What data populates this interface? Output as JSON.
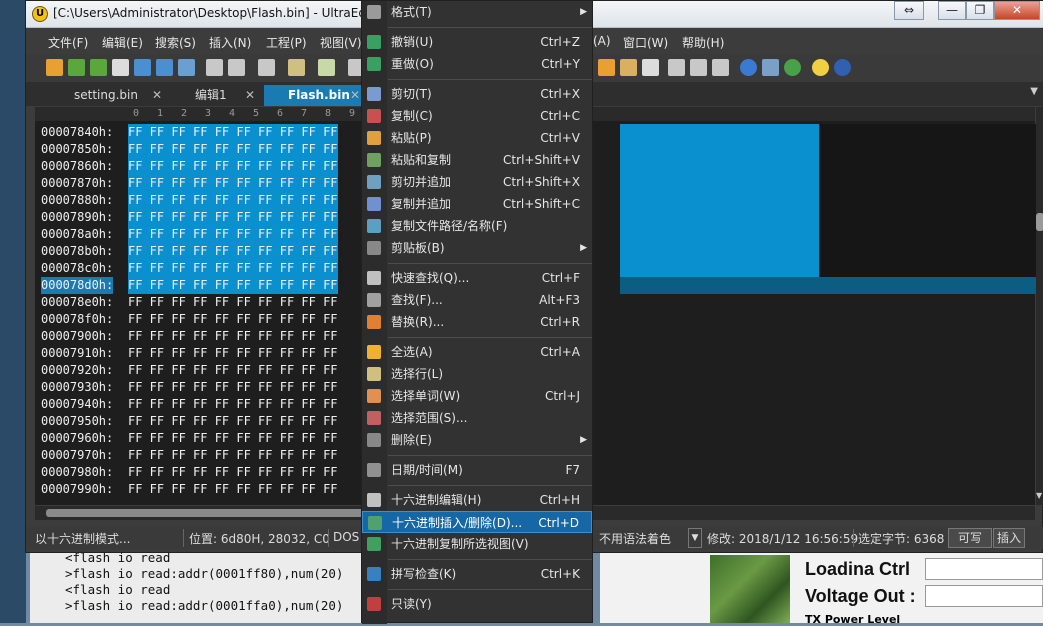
{
  "window": {
    "title": "[C:\\Users\\Administrator\\Desktop\\Flash.bin] - UltraEdi",
    "controls": {
      "swap": "⇔",
      "minimize": "—",
      "restore": "❐",
      "close": "✕"
    }
  },
  "menubar": [
    "文件(F)",
    "编辑(E)",
    "搜索(S)",
    "插入(N)",
    "工程(P)",
    "视图(V)",
    "(A)",
    "窗口(W)",
    "帮助(H)"
  ],
  "tabs": [
    {
      "label": "setting.bin",
      "close": "✕"
    },
    {
      "label": "编辑1",
      "close": "✕"
    },
    {
      "label": "Flash.bin",
      "close": "✕"
    }
  ],
  "ruler": [
    "0",
    "1",
    "2",
    "3",
    "4",
    "5",
    "6",
    "7",
    "8",
    "9"
  ],
  "hex_rows": [
    {
      "addr": "00007840h:",
      "hex": "FF FF FF FF FF FF FF FF FF FF"
    },
    {
      "addr": "00007850h:",
      "hex": "FF FF FF FF FF FF FF FF FF FF"
    },
    {
      "addr": "00007860h:",
      "hex": "FF FF FF FF FF FF FF FF FF FF"
    },
    {
      "addr": "00007870h:",
      "hex": "FF FF FF FF FF FF FF FF FF FF"
    },
    {
      "addr": "00007880h:",
      "hex": "FF FF FF FF FF FF FF FF FF FF"
    },
    {
      "addr": "00007890h:",
      "hex": "FF FF FF FF FF FF FF FF FF FF"
    },
    {
      "addr": "000078a0h:",
      "hex": "FF FF FF FF FF FF FF FF FF FF"
    },
    {
      "addr": "000078b0h:",
      "hex": "FF FF FF FF FF FF FF FF FF FF"
    },
    {
      "addr": "000078c0h:",
      "hex": "FF FF FF FF FF FF FF FF FF FF"
    },
    {
      "addr": "000078d0h:",
      "hex": "FF FF FF FF FF FF FF FF FF FF"
    },
    {
      "addr": "000078e0h:",
      "hex": "FF FF FF FF FF FF FF FF FF FF"
    },
    {
      "addr": "000078f0h:",
      "hex": "FF FF FF FF FF FF FF FF FF FF"
    },
    {
      "addr": "00007900h:",
      "hex": "FF FF FF FF FF FF FF FF FF FF"
    },
    {
      "addr": "00007910h:",
      "hex": "FF FF FF FF FF FF FF FF FF FF"
    },
    {
      "addr": "00007920h:",
      "hex": "FF FF FF FF FF FF FF FF FF FF"
    },
    {
      "addr": "00007930h:",
      "hex": "FF FF FF FF FF FF FF FF FF FF"
    },
    {
      "addr": "00007940h:",
      "hex": "FF FF FF FF FF FF FF FF FF FF"
    },
    {
      "addr": "00007950h:",
      "hex": "FF FF FF FF FF FF FF FF FF FF"
    },
    {
      "addr": "00007960h:",
      "hex": "FF FF FF FF FF FF FF FF FF FF"
    },
    {
      "addr": "00007970h:",
      "hex": "FF FF FF FF FF FF FF FF FF FF"
    },
    {
      "addr": "00007980h:",
      "hex": "FF FF FF FF FF FF FF FF FF FF"
    },
    {
      "addr": "00007990h:",
      "hex": "FF FF FF FF FF FF FF FF FF FF"
    }
  ],
  "statusbar": {
    "mode": "以十六进制模式...",
    "position": "位置: 6d80H, 28032, C0",
    "format": "DOS",
    "syntax": "不用语法着色",
    "modified": "修改: 2018/1/12 16:56:59",
    "selected": "选定字节: 6368",
    "writable": "可写",
    "insert": "插入"
  },
  "context_menu": [
    {
      "label": "格式(T)",
      "shortcut": "",
      "submenu": true,
      "icon": "format-icon"
    },
    {
      "label": "撤销(U)",
      "shortcut": "Ctrl+Z",
      "icon": "undo-icon"
    },
    {
      "label": "重做(O)",
      "shortcut": "Ctrl+Y",
      "icon": "redo-icon"
    },
    {
      "label": "剪切(T)",
      "shortcut": "Ctrl+X",
      "icon": "cut-icon"
    },
    {
      "label": "复制(C)",
      "shortcut": "Ctrl+C",
      "icon": "copy-icon"
    },
    {
      "label": "粘贴(P)",
      "shortcut": "Ctrl+V",
      "icon": "paste-icon"
    },
    {
      "label": "粘贴和复制",
      "shortcut": "Ctrl+Shift+V",
      "icon": "paste-copy-icon"
    },
    {
      "label": "剪切并追加",
      "shortcut": "Ctrl+Shift+X",
      "icon": "cut-append-icon"
    },
    {
      "label": "复制并追加",
      "shortcut": "Ctrl+Shift+C",
      "icon": "copy-append-icon"
    },
    {
      "label": "复制文件路径/名称(F)",
      "shortcut": "",
      "icon": "copy-path-icon"
    },
    {
      "label": "剪贴板(B)",
      "shortcut": "",
      "submenu": true,
      "icon": "clipboard-icon"
    },
    {
      "label": "快速查找(Q)...",
      "shortcut": "Ctrl+F",
      "icon": "quick-find-icon"
    },
    {
      "label": "查找(F)...",
      "shortcut": "Alt+F3",
      "icon": "find-icon"
    },
    {
      "label": "替换(R)...",
      "shortcut": "Ctrl+R",
      "icon": "replace-icon"
    },
    {
      "label": "全选(A)",
      "shortcut": "Ctrl+A",
      "icon": "select-all-icon"
    },
    {
      "label": "选择行(L)",
      "shortcut": "",
      "icon": "select-line-icon"
    },
    {
      "label": "选择单词(W)",
      "shortcut": "Ctrl+J",
      "icon": "select-word-icon"
    },
    {
      "label": "选择范围(S)...",
      "shortcut": "",
      "icon": "select-range-icon"
    },
    {
      "label": "删除(E)",
      "shortcut": "",
      "submenu": true,
      "icon": "delete-icon"
    },
    {
      "label": "日期/时间(M)",
      "shortcut": "F7",
      "icon": "datetime-icon"
    },
    {
      "label": "十六进制编辑(H)",
      "shortcut": "Ctrl+H",
      "icon": "hex-edit-icon"
    },
    {
      "label": "十六进制插入/删除(D)...",
      "shortcut": "Ctrl+D",
      "icon": "hex-insert-icon",
      "highlighted": true
    },
    {
      "label": "十六进制复制所选视图(V)",
      "shortcut": "",
      "icon": "hex-copy-icon"
    },
    {
      "label": "拼写检查(K)",
      "shortcut": "Ctrl+K",
      "icon": "spellcheck-icon"
    },
    {
      "label": "只读(Y)",
      "shortcut": "",
      "icon": "readonly-icon"
    }
  ],
  "console_lines": [
    "<flash io read",
    ">flash io read:addr(0001ff80),num(20)",
    "<flash io read",
    ">flash io read:addr(0001ffa0),num(20)"
  ],
  "gui_labels": {
    "loading": "Loadina Ctrl",
    "voltage": "Voltage Out :",
    "tx": "TX Power Level"
  },
  "colors": {
    "selection": "#0a8fcf",
    "menu_highlight": "#1667a5",
    "tab_active": "#1a7ab2"
  }
}
